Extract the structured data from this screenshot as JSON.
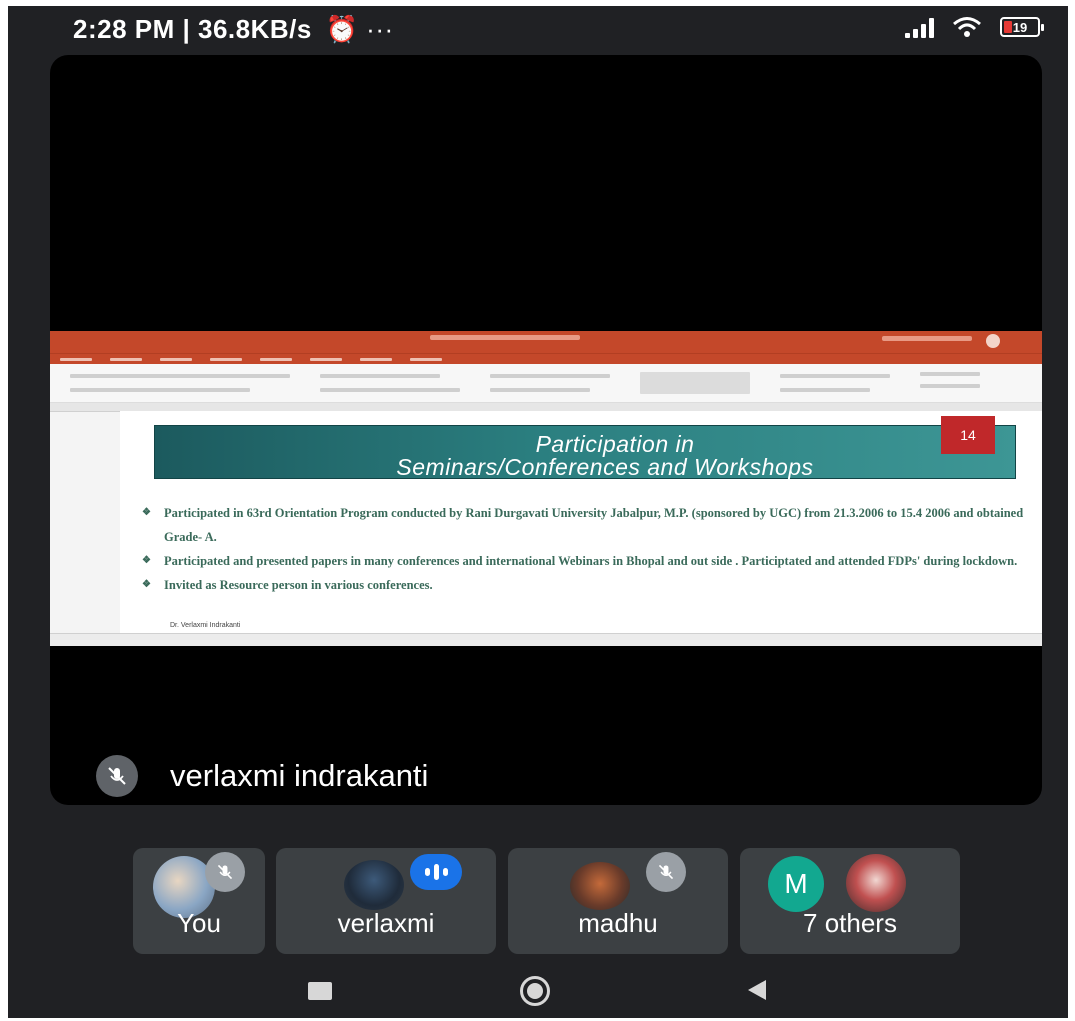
{
  "status_bar": {
    "time_info": "2:28 PM | 36.8KB/s",
    "extra_icons": "⏰ ···",
    "battery": "19"
  },
  "presentation": {
    "slide_number": "14",
    "title_line1": "Participation in",
    "title_line2": "Seminars/Conferences and Workshops",
    "bullets": [
      "Participated in 63rd Orientation Program  conducted by Rani Durgavati University Jabalpur, M.P. (sponsored by UGC) from 21.3.2006 to 15.4 2006 and obtained Grade- A.",
      "Participated and presented papers in many conferences and international Webinars in Bhopal and out side . Participtated and attended FDPs' during lockdown.",
      "Invited as Resource person in various conferences."
    ],
    "author": "Dr. Verlaxmi Indrakanti"
  },
  "speaker": {
    "name": "verlaxmi indrakanti"
  },
  "participants": [
    {
      "label": "You"
    },
    {
      "label": "verlaxmi"
    },
    {
      "label": "madhu"
    },
    {
      "label": "7 others",
      "avatar_letter": "M"
    }
  ],
  "colors": {
    "meet_blue": "#1a73e8",
    "avatar_teal": "#12a890",
    "ppt_orange": "#c4482a",
    "slide_teal": "#2b7f80"
  }
}
